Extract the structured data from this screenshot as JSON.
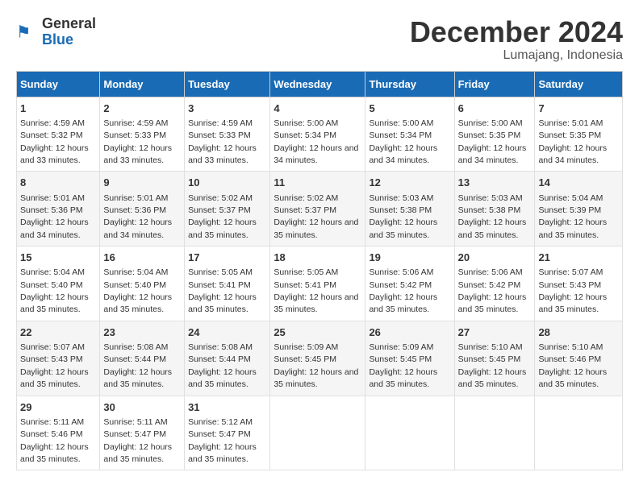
{
  "logo": {
    "general": "General",
    "blue": "Blue"
  },
  "title": "December 2024",
  "subtitle": "Lumajang, Indonesia",
  "weekdays": [
    "Sunday",
    "Monday",
    "Tuesday",
    "Wednesday",
    "Thursday",
    "Friday",
    "Saturday"
  ],
  "weeks": [
    [
      {
        "day": "1",
        "sunrise": "4:59 AM",
        "sunset": "5:32 PM",
        "daylight": "12 hours and 33 minutes."
      },
      {
        "day": "2",
        "sunrise": "4:59 AM",
        "sunset": "5:33 PM",
        "daylight": "12 hours and 33 minutes."
      },
      {
        "day": "3",
        "sunrise": "4:59 AM",
        "sunset": "5:33 PM",
        "daylight": "12 hours and 33 minutes."
      },
      {
        "day": "4",
        "sunrise": "5:00 AM",
        "sunset": "5:34 PM",
        "daylight": "12 hours and 34 minutes."
      },
      {
        "day": "5",
        "sunrise": "5:00 AM",
        "sunset": "5:34 PM",
        "daylight": "12 hours and 34 minutes."
      },
      {
        "day": "6",
        "sunrise": "5:00 AM",
        "sunset": "5:35 PM",
        "daylight": "12 hours and 34 minutes."
      },
      {
        "day": "7",
        "sunrise": "5:01 AM",
        "sunset": "5:35 PM",
        "daylight": "12 hours and 34 minutes."
      }
    ],
    [
      {
        "day": "8",
        "sunrise": "5:01 AM",
        "sunset": "5:36 PM",
        "daylight": "12 hours and 34 minutes."
      },
      {
        "day": "9",
        "sunrise": "5:01 AM",
        "sunset": "5:36 PM",
        "daylight": "12 hours and 34 minutes."
      },
      {
        "day": "10",
        "sunrise": "5:02 AM",
        "sunset": "5:37 PM",
        "daylight": "12 hours and 35 minutes."
      },
      {
        "day": "11",
        "sunrise": "5:02 AM",
        "sunset": "5:37 PM",
        "daylight": "12 hours and 35 minutes."
      },
      {
        "day": "12",
        "sunrise": "5:03 AM",
        "sunset": "5:38 PM",
        "daylight": "12 hours and 35 minutes."
      },
      {
        "day": "13",
        "sunrise": "5:03 AM",
        "sunset": "5:38 PM",
        "daylight": "12 hours and 35 minutes."
      },
      {
        "day": "14",
        "sunrise": "5:04 AM",
        "sunset": "5:39 PM",
        "daylight": "12 hours and 35 minutes."
      }
    ],
    [
      {
        "day": "15",
        "sunrise": "5:04 AM",
        "sunset": "5:40 PM",
        "daylight": "12 hours and 35 minutes."
      },
      {
        "day": "16",
        "sunrise": "5:04 AM",
        "sunset": "5:40 PM",
        "daylight": "12 hours and 35 minutes."
      },
      {
        "day": "17",
        "sunrise": "5:05 AM",
        "sunset": "5:41 PM",
        "daylight": "12 hours and 35 minutes."
      },
      {
        "day": "18",
        "sunrise": "5:05 AM",
        "sunset": "5:41 PM",
        "daylight": "12 hours and 35 minutes."
      },
      {
        "day": "19",
        "sunrise": "5:06 AM",
        "sunset": "5:42 PM",
        "daylight": "12 hours and 35 minutes."
      },
      {
        "day": "20",
        "sunrise": "5:06 AM",
        "sunset": "5:42 PM",
        "daylight": "12 hours and 35 minutes."
      },
      {
        "day": "21",
        "sunrise": "5:07 AM",
        "sunset": "5:43 PM",
        "daylight": "12 hours and 35 minutes."
      }
    ],
    [
      {
        "day": "22",
        "sunrise": "5:07 AM",
        "sunset": "5:43 PM",
        "daylight": "12 hours and 35 minutes."
      },
      {
        "day": "23",
        "sunrise": "5:08 AM",
        "sunset": "5:44 PM",
        "daylight": "12 hours and 35 minutes."
      },
      {
        "day": "24",
        "sunrise": "5:08 AM",
        "sunset": "5:44 PM",
        "daylight": "12 hours and 35 minutes."
      },
      {
        "day": "25",
        "sunrise": "5:09 AM",
        "sunset": "5:45 PM",
        "daylight": "12 hours and 35 minutes."
      },
      {
        "day": "26",
        "sunrise": "5:09 AM",
        "sunset": "5:45 PM",
        "daylight": "12 hours and 35 minutes."
      },
      {
        "day": "27",
        "sunrise": "5:10 AM",
        "sunset": "5:45 PM",
        "daylight": "12 hours and 35 minutes."
      },
      {
        "day": "28",
        "sunrise": "5:10 AM",
        "sunset": "5:46 PM",
        "daylight": "12 hours and 35 minutes."
      }
    ],
    [
      {
        "day": "29",
        "sunrise": "5:11 AM",
        "sunset": "5:46 PM",
        "daylight": "12 hours and 35 minutes."
      },
      {
        "day": "30",
        "sunrise": "5:11 AM",
        "sunset": "5:47 PM",
        "daylight": "12 hours and 35 minutes."
      },
      {
        "day": "31",
        "sunrise": "5:12 AM",
        "sunset": "5:47 PM",
        "daylight": "12 hours and 35 minutes."
      },
      null,
      null,
      null,
      null
    ]
  ]
}
